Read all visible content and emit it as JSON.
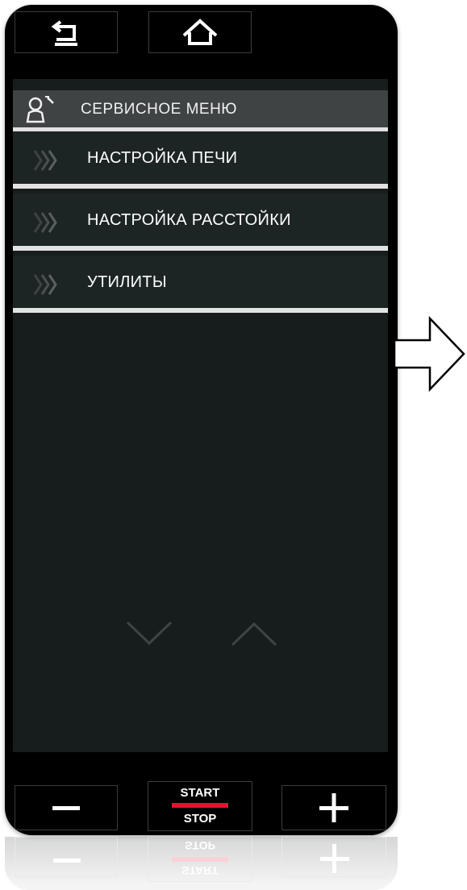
{
  "topbar": {
    "back_icon": "return-arrow-icon",
    "home_icon": "home-icon"
  },
  "header": {
    "icon": "service-user-wrench-icon",
    "title": "СЕРВИСНОЕ  МЕНЮ"
  },
  "menu": {
    "items": [
      {
        "label": "НАСТРОЙКА ПЕЧИ",
        "icon": "triple-chevron-right-icon"
      },
      {
        "label": "НАСТРОЙКА РАССТОЙКИ",
        "icon": "triple-chevron-right-icon"
      },
      {
        "label": "УТИЛИТЫ",
        "icon": "triple-chevron-right-icon"
      }
    ]
  },
  "scroll": {
    "down_icon": "chevron-down-icon",
    "up_icon": "chevron-up-icon"
  },
  "bottombar": {
    "minus_icon": "minus-icon",
    "start_label": "START",
    "stop_label": "STOP",
    "plus_icon": "plus-icon"
  },
  "reflection": {
    "start_label": "START",
    "stop_label": "STOP"
  },
  "colors": {
    "screen_bg": "#171c1c",
    "header_bg": "#3f4343",
    "item_bg": "#1d2424",
    "divider": "#e2e2e2",
    "accent_red": "#e5122e"
  },
  "annotation": {
    "arrow_icon": "outline-right-arrow-icon"
  }
}
